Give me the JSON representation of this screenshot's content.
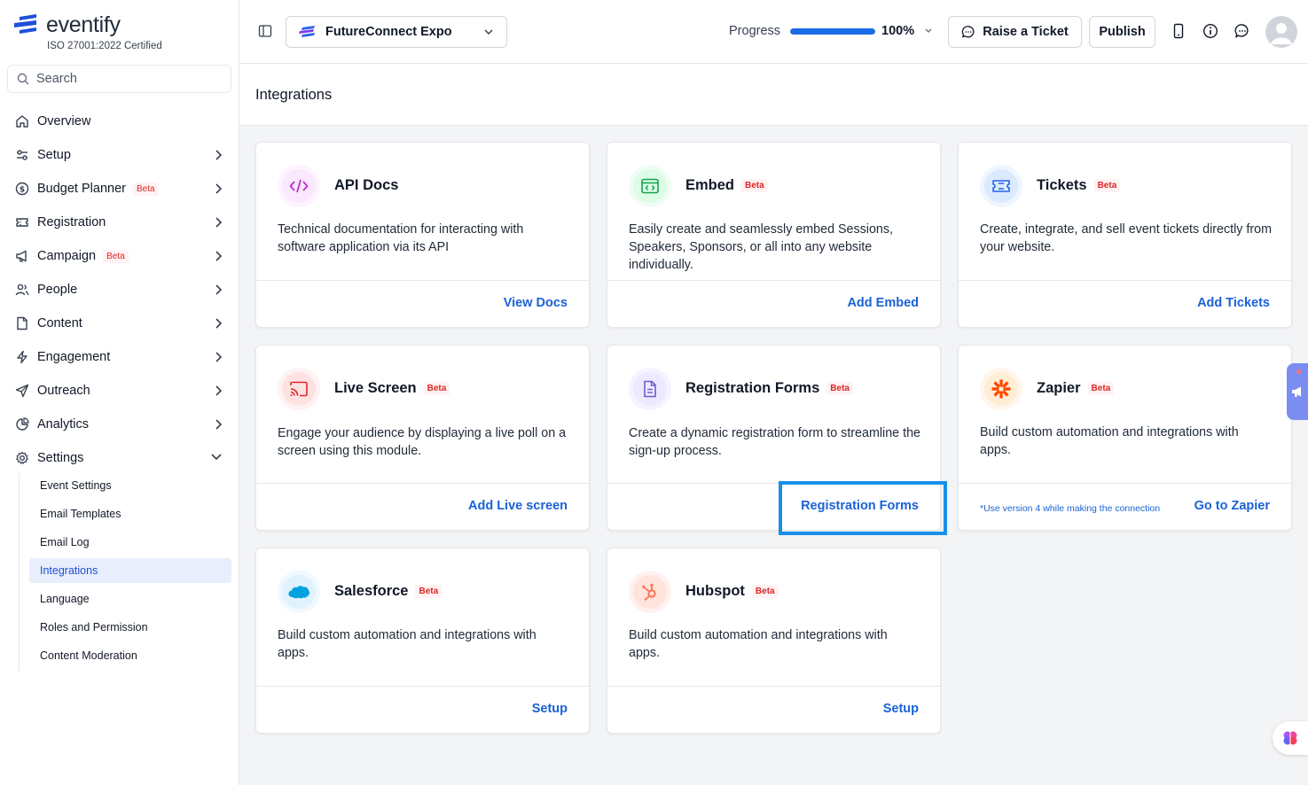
{
  "app": {
    "name": "eventify",
    "certification": "ISO 27001:2022 Certified"
  },
  "sidebar": {
    "search_placeholder": "Search",
    "items": [
      {
        "label": "Overview",
        "icon": "home-icon",
        "chevron": ""
      },
      {
        "label": "Setup",
        "icon": "sliders-icon",
        "chevron": "right"
      },
      {
        "label": "Budget Planner",
        "icon": "dollar-icon",
        "badge": "Beta",
        "chevron": "right"
      },
      {
        "label": "Registration",
        "icon": "ticket-icon",
        "chevron": "right"
      },
      {
        "label": "Campaign",
        "icon": "megaphone-icon",
        "badge": "Beta",
        "chevron": "right"
      },
      {
        "label": "People",
        "icon": "users-icon",
        "chevron": "right"
      },
      {
        "label": "Content",
        "icon": "file-icon",
        "chevron": "right"
      },
      {
        "label": "Engagement",
        "icon": "bolt-icon",
        "chevron": "right"
      },
      {
        "label": "Outreach",
        "icon": "send-icon",
        "chevron": "right"
      },
      {
        "label": "Analytics",
        "icon": "pie-chart-icon",
        "chevron": "right"
      },
      {
        "label": "Settings",
        "icon": "gear-icon",
        "chevron": "down"
      }
    ],
    "settings_subitems": [
      "Event Settings",
      "Email Templates",
      "Email Log",
      "Integrations",
      "Language",
      "Roles and Permission",
      "Content Moderation"
    ],
    "active_subitem": "Integrations"
  },
  "topbar": {
    "event_name": "FutureConnect Expo",
    "progress_label": "Progress",
    "progress_value": "100%",
    "progress_fraction": 1.0,
    "raise_ticket_label": "Raise a Ticket",
    "publish_label": "Publish"
  },
  "page": {
    "title": "Integrations"
  },
  "cards": [
    {
      "title": "API Docs",
      "badge": "",
      "description": "Technical documentation for interacting with software application via its API",
      "action": "View Docs",
      "note": "",
      "icon": "code-icon",
      "color": "#c026d3",
      "bg": "#fae8ff"
    },
    {
      "title": "Embed",
      "badge": "Beta",
      "description": "Easily create and seamlessly embed Sessions, Speakers, Sponsors, or all into any website individually.",
      "action": "Add Embed",
      "note": "",
      "icon": "embed-icon",
      "color": "#16a34a",
      "bg": "#dcfce7"
    },
    {
      "title": "Tickets",
      "badge": "Beta",
      "description": "Create, integrate, and sell event tickets directly from your website.",
      "action": "Add Tickets",
      "note": "",
      "icon": "ticket-icon",
      "color": "#2563eb",
      "bg": "#dbeafe"
    },
    {
      "title": "Live Screen",
      "badge": "Beta",
      "description": "Engage your audience by displaying a live poll on a screen using this module.",
      "action": "Add Live screen",
      "note": "",
      "icon": "cast-icon",
      "color": "#dc2626",
      "bg": "#fee2e2"
    },
    {
      "title": "Registration Forms",
      "badge": "Beta",
      "description": "Create a dynamic registration form to streamline the sign-up process.",
      "action": "Registration Forms",
      "note": "",
      "icon": "document-icon",
      "color": "#6d5bd0",
      "bg": "#ede9fe"
    },
    {
      "title": "Zapier",
      "badge": "Beta",
      "description": "Build custom automation and integrations with apps.",
      "action": "Go to Zapier",
      "note": "*Use version 4 while making the connection",
      "icon": "zapier-icon",
      "color": "#ff4a00",
      "bg": "#ffedd5"
    },
    {
      "title": "Salesforce",
      "badge": "Beta",
      "description": "Build custom automation and integrations with apps.",
      "action": "Setup",
      "note": "",
      "icon": "salesforce-icon",
      "color": "#00a1e0",
      "bg": "#e0f2fe"
    },
    {
      "title": "Hubspot",
      "badge": "Beta",
      "description": "Build custom automation and integrations with apps.",
      "action": "Setup",
      "note": "",
      "icon": "hubspot-icon",
      "color": "#ff7a59",
      "bg": "#ffe4dc"
    }
  ]
}
